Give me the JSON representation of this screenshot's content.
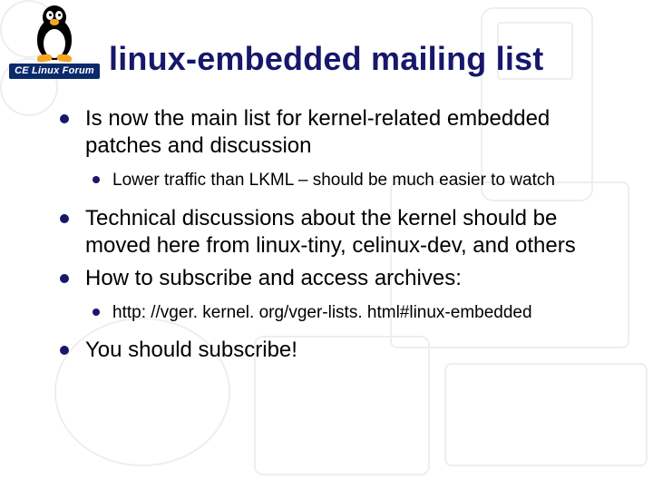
{
  "logo": {
    "banner_text": "CE Linux Forum"
  },
  "slide": {
    "title": "linux-embedded mailing list",
    "bullets": [
      {
        "text": "Is now the main list for kernel-related embedded patches and discussion",
        "sub": [
          "Lower traffic than LKML – should be much easier to watch"
        ]
      },
      {
        "text": "Technical discussions about the kernel should be moved here from linux-tiny, celinux-dev, and others",
        "sub": []
      },
      {
        "text": "How to subscribe and access archives:",
        "sub": [
          "http: //vger. kernel. org/vger-lists. html#linux-embedded"
        ]
      },
      {
        "text": "You should subscribe!",
        "sub": []
      }
    ]
  }
}
